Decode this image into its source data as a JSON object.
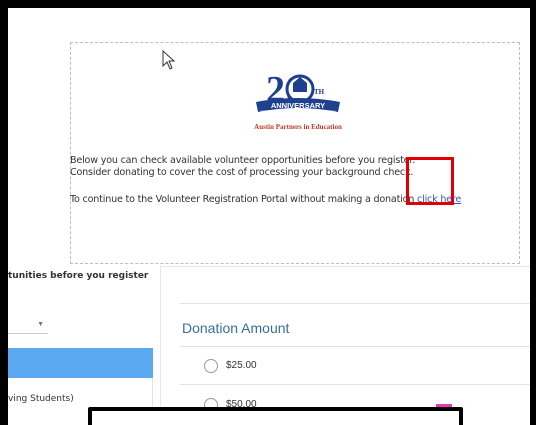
{
  "logo": {
    "number": "20",
    "suffix": "TH",
    "banner": "ANNIVERSARY",
    "year_left": "2004",
    "year_right": "2024",
    "org_name": "Austin Partners in Education",
    "colors": {
      "blue": "#1f3f8f",
      "red": "#c0392b"
    }
  },
  "message": {
    "line1": "Below you can check available volunteer opportunities before you register.",
    "line2": "Consider donating to cover the cost of processing your background check.",
    "line3_prefix": "To continue to the Volunteer Registration Portal without making a donation ",
    "link_text": "click here"
  },
  "left_panel": {
    "heading": "tunities before you register",
    "list_item": "ving Students)",
    "selected_color": "#5aa9f0"
  },
  "donation": {
    "title": "Donation Amount",
    "options": [
      {
        "label": "$25.00"
      },
      {
        "label": "$50.00"
      }
    ]
  },
  "colors": {
    "highlight": "#e00000",
    "link": "#3355cc",
    "title": "#3a6e9a",
    "accent_pink": "#e43bb1"
  }
}
